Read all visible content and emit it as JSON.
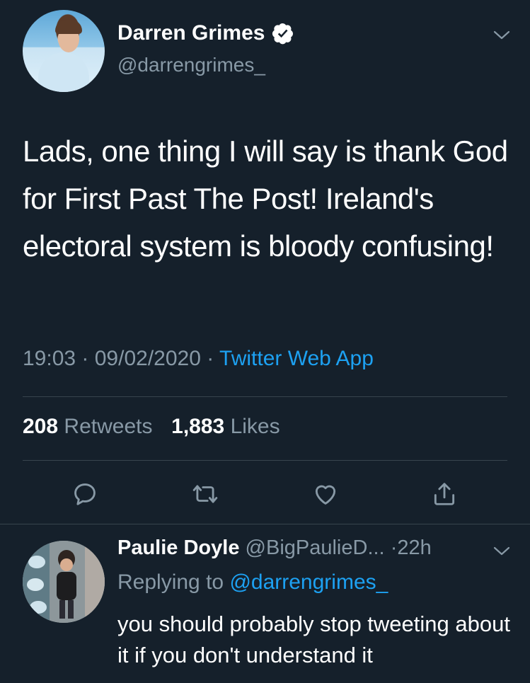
{
  "tweet": {
    "author_name": "Darren Grimes",
    "author_handle": "@darrengrimes_",
    "text": "Lads, one thing I will say is thank God for First Past The Post! Ireland's electoral system is bloody confusing!",
    "time": "19:03",
    "date": "09/02/2020",
    "source": "Twitter Web App",
    "retweets_count": "208",
    "retweets_label": "Retweets",
    "likes_count": "1,883",
    "likes_label": "Likes",
    "icons": {
      "verified": "verified-badge-icon",
      "menu": "chevron-down-icon",
      "reply": "reply-icon",
      "retweet": "retweet-icon",
      "like": "heart-icon",
      "share": "share-icon"
    }
  },
  "reply": {
    "author_name": "Paulie Doyle",
    "author_handle": "@BigPaulieD...",
    "time": "22h",
    "replying_prefix": "Replying to",
    "replying_to": "@darrengrimes_",
    "text": "you should probably stop tweeting about it if you don't understand it"
  },
  "colors": {
    "background": "#15202b",
    "secondary_text": "#8899a6",
    "link": "#1da1f2",
    "divider": "#38444d"
  }
}
